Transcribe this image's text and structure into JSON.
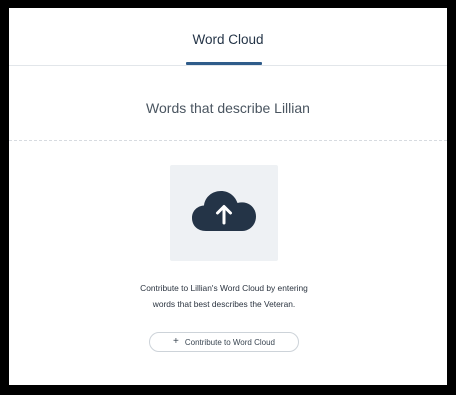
{
  "tabs": [
    {
      "label": "Word Cloud",
      "active": true
    }
  ],
  "section": {
    "title": "Words that describe Lillian"
  },
  "upload": {
    "icon": "cloud-upload-icon"
  },
  "description": {
    "line1": "Contribute to Lillian's Word Cloud by entering",
    "line2": "words that best describes the Veteran."
  },
  "contribute_button": {
    "icon": "plus-icon",
    "icon_glyph": "+",
    "label": "Contribute to Word Cloud"
  },
  "colors": {
    "accent": "#2f5c8a",
    "text_dark": "#243447",
    "cloud_fill": "#243447",
    "upload_bg": "#eef1f4"
  }
}
